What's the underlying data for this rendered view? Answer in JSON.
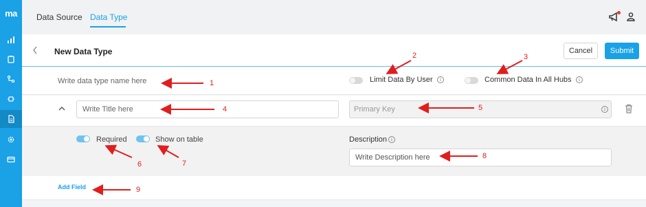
{
  "app": {
    "logo_text": "ma",
    "nav_icons": [
      "bar-chart-icon",
      "clipboard-icon",
      "workflow-icon",
      "plug-icon",
      "document-icon",
      "settings-icon",
      "card-icon"
    ]
  },
  "topbar": {
    "tabs": [
      {
        "label": "Data Source",
        "active": false
      },
      {
        "label": "Data Type",
        "active": true
      }
    ]
  },
  "header": {
    "title": "New Data Type",
    "cancel_label": "Cancel",
    "submit_label": "Submit"
  },
  "name_row": {
    "placeholder": "Write data type name here",
    "limit_by_user": {
      "label": "Limit Data By User",
      "on": false
    },
    "common_in_hubs": {
      "label": "Common Data In All Hubs",
      "on": false
    }
  },
  "field": {
    "title_placeholder": "Write Title here",
    "primary_key_placeholder": "Primary Key",
    "required": {
      "label": "Required",
      "on": true
    },
    "show_on_table": {
      "label": "Show on table",
      "on": true
    },
    "description_label": "Description",
    "description_placeholder": "Write Description here"
  },
  "add_field_label": "Add Field",
  "annotations": [
    "1",
    "2",
    "3",
    "4",
    "5",
    "6",
    "7",
    "8",
    "9"
  ],
  "colors": {
    "accent": "#1aa1e6",
    "annotation": "#e01e1e"
  }
}
